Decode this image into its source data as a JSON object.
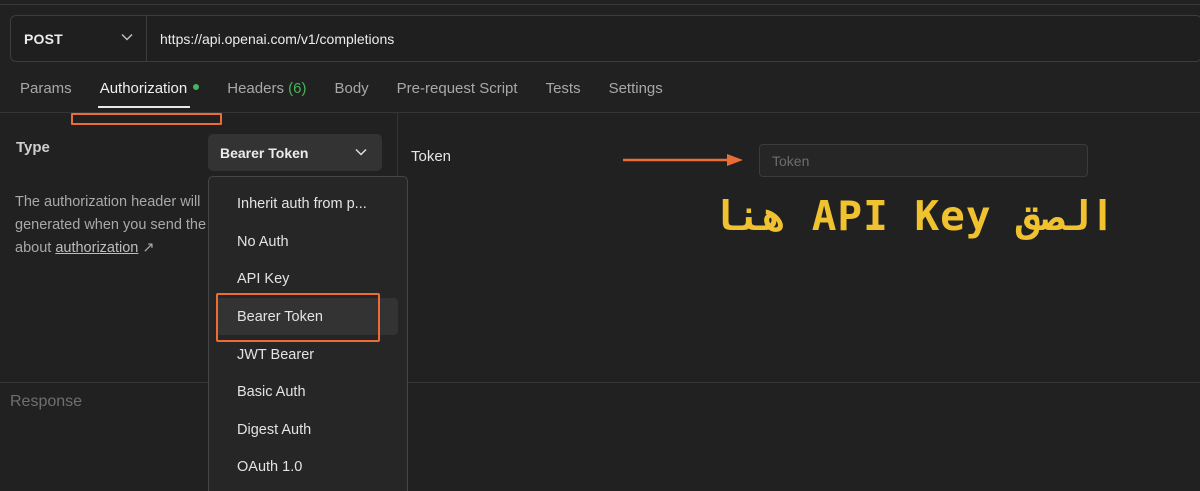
{
  "request": {
    "method": "POST",
    "url": "https://api.openai.com/v1/completions"
  },
  "tabs": [
    {
      "label": "Params"
    },
    {
      "label": "Authorization"
    },
    {
      "label": "Headers",
      "count": "(6)"
    },
    {
      "label": "Body"
    },
    {
      "label": "Pre-request Script"
    },
    {
      "label": "Tests"
    },
    {
      "label": "Settings"
    }
  ],
  "auth": {
    "type_label": "Type",
    "selected_type": "Bearer Token",
    "description_lines": [
      "The authorization header will",
      "generated when you send the"
    ],
    "description_about": "about",
    "description_link": "authorization",
    "link_icon": "↗",
    "token_label": "Token",
    "token_placeholder": "Token",
    "token_value": ""
  },
  "dropdown": {
    "items": [
      "Inherit auth from p...",
      "No Auth",
      "API Key",
      "Bearer Token",
      "JWT Bearer",
      "Basic Auth",
      "Digest Auth",
      "OAuth 1.0"
    ],
    "hovered": "Bearer Token"
  },
  "annotation": {
    "text": "الصق API Key هنا",
    "color": "#f1c230"
  },
  "response": {
    "label": "Response"
  },
  "colors": {
    "background": "#212121",
    "highlight": "#ea6d38",
    "success": "#47b35c"
  },
  "icons": [
    "chevron-down-icon",
    "external-link-icon",
    "arrow-right-icon"
  ]
}
